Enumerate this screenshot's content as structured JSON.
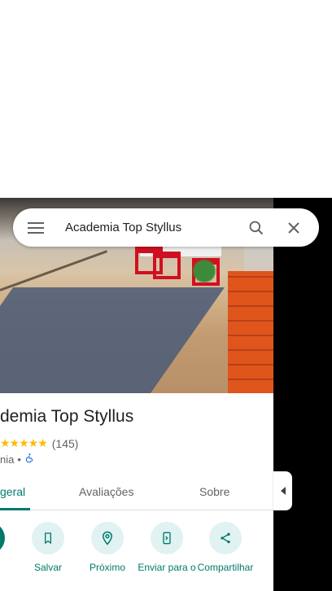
{
  "search": {
    "query": "Academia Top Styllus"
  },
  "place": {
    "name": "demia Top Styllus",
    "stars": "★★★★★",
    "review_count": "(145)",
    "category": "nia",
    "separator": "•"
  },
  "tabs": [
    {
      "label": "geral",
      "active": true
    },
    {
      "label": "Avaliações",
      "active": false
    },
    {
      "label": "Sobre",
      "active": false
    }
  ],
  "actions": [
    {
      "label": "s",
      "icon": "directions-icon"
    },
    {
      "label": "Salvar",
      "icon": "bookmark-icon"
    },
    {
      "label": "Próximo",
      "icon": "nearby-icon"
    },
    {
      "label": "Enviar para o",
      "icon": "send-to-phone-icon"
    },
    {
      "label": "Compartilhar",
      "icon": "share-icon"
    }
  ],
  "colors": {
    "accent": "#00796b",
    "accent_light": "#e0f2f1",
    "star": "#fbbc04"
  }
}
